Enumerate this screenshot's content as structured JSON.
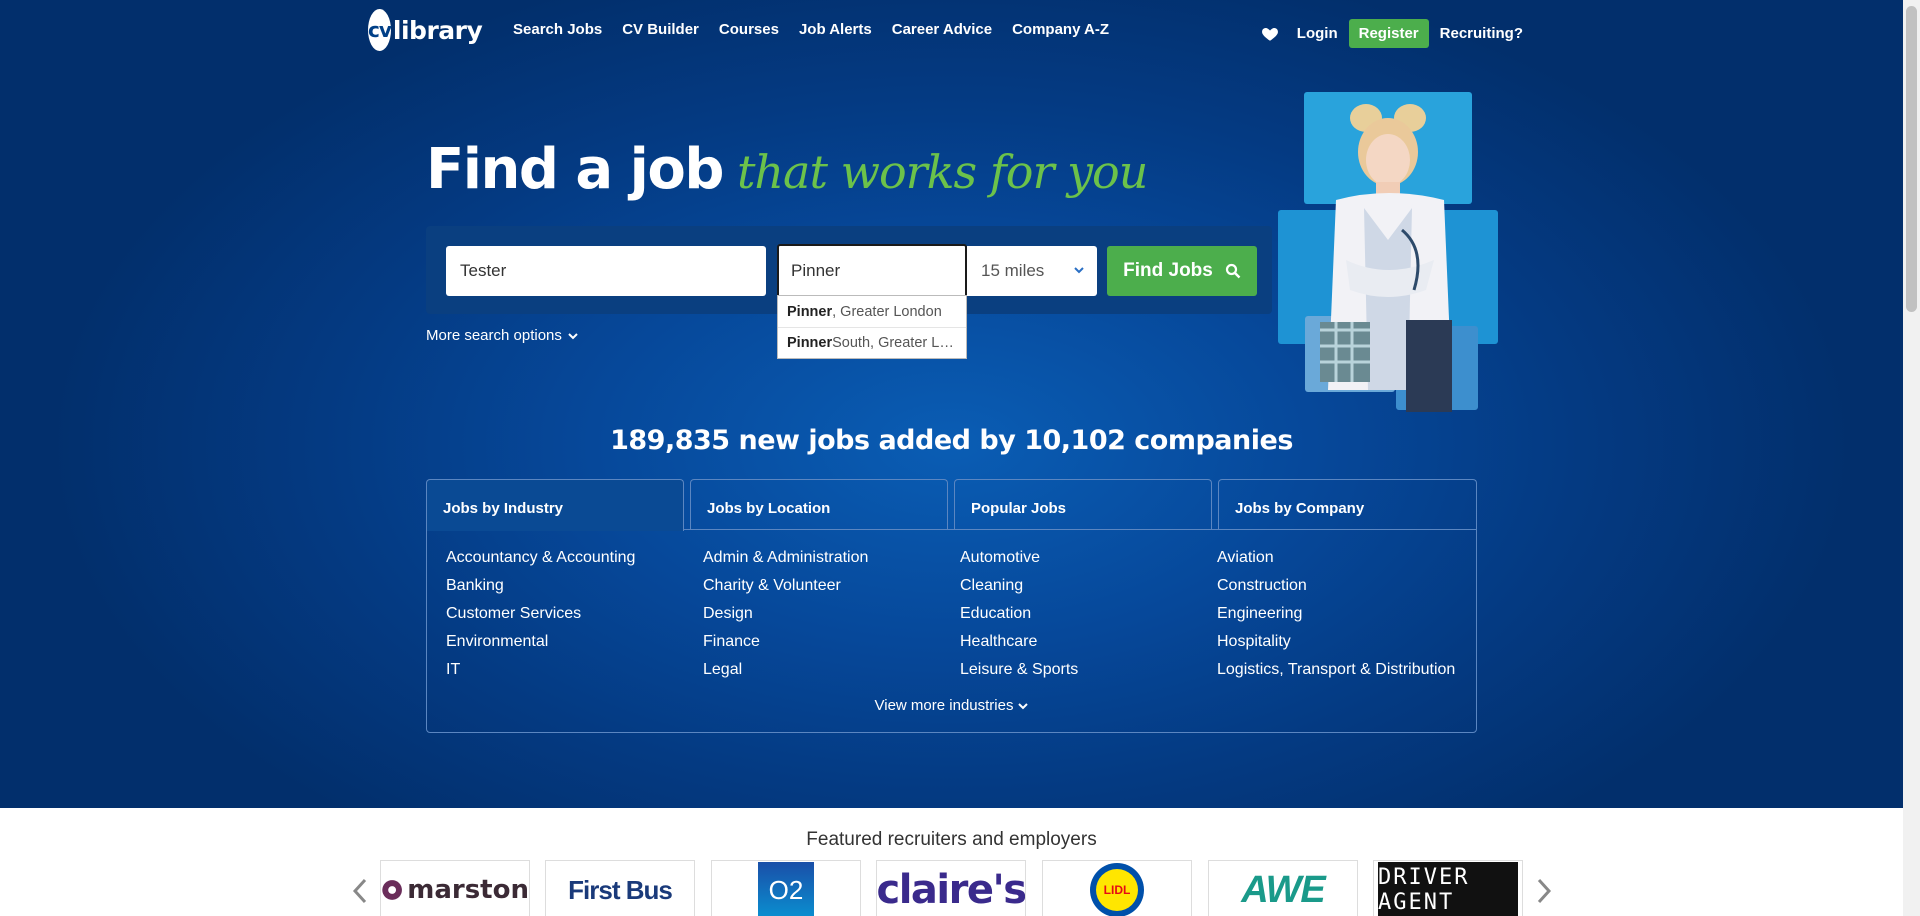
{
  "nav": {
    "logo_cv": "cv",
    "logo_text": "library",
    "links": [
      "Search Jobs",
      "CV Builder",
      "Courses",
      "Job Alerts",
      "Career Advice",
      "Company A-Z"
    ],
    "login": "Login",
    "register": "Register",
    "recruiting": "Recruiting?"
  },
  "headline": {
    "main": "Find a job",
    "script": "that works for you"
  },
  "search": {
    "keywords_value": "Tester",
    "location_value": "Pinner",
    "radius": "15 miles",
    "find_button": "Find Jobs",
    "more_options": "More search options"
  },
  "autocomplete": [
    {
      "match": "Pinner",
      "rest": ", Greater London"
    },
    {
      "match": "Pinner",
      "rest": " South, Greater London"
    }
  ],
  "stats": "189,835 new jobs added by 10,102 companies",
  "tabs": [
    "Jobs by Industry",
    "Jobs by Location",
    "Popular Jobs",
    "Jobs by Company"
  ],
  "industries": [
    [
      "Accountancy & Accounting",
      "Banking",
      "Customer Services",
      "Environmental",
      "IT"
    ],
    [
      "Admin & Administration",
      "Charity & Volunteer",
      "Design",
      "Finance",
      "Legal"
    ],
    [
      "Automotive",
      "Cleaning",
      "Education",
      "Healthcare",
      "Leisure & Sports"
    ],
    [
      "Aviation",
      "Construction",
      "Engineering",
      "Hospitality",
      "Logistics, Transport & Distribution"
    ]
  ],
  "view_more": "View more industries",
  "featured": {
    "title": "Featured recruiters and employers",
    "logos": [
      "marston",
      "First Bus",
      "O2",
      "claire's",
      "LIDL",
      "AWE",
      "DRIVER AGENT"
    ]
  },
  "colors": {
    "brand_blue": "#043a82",
    "accent_green": "#4cae4c",
    "script_green": "#6cc24a"
  }
}
